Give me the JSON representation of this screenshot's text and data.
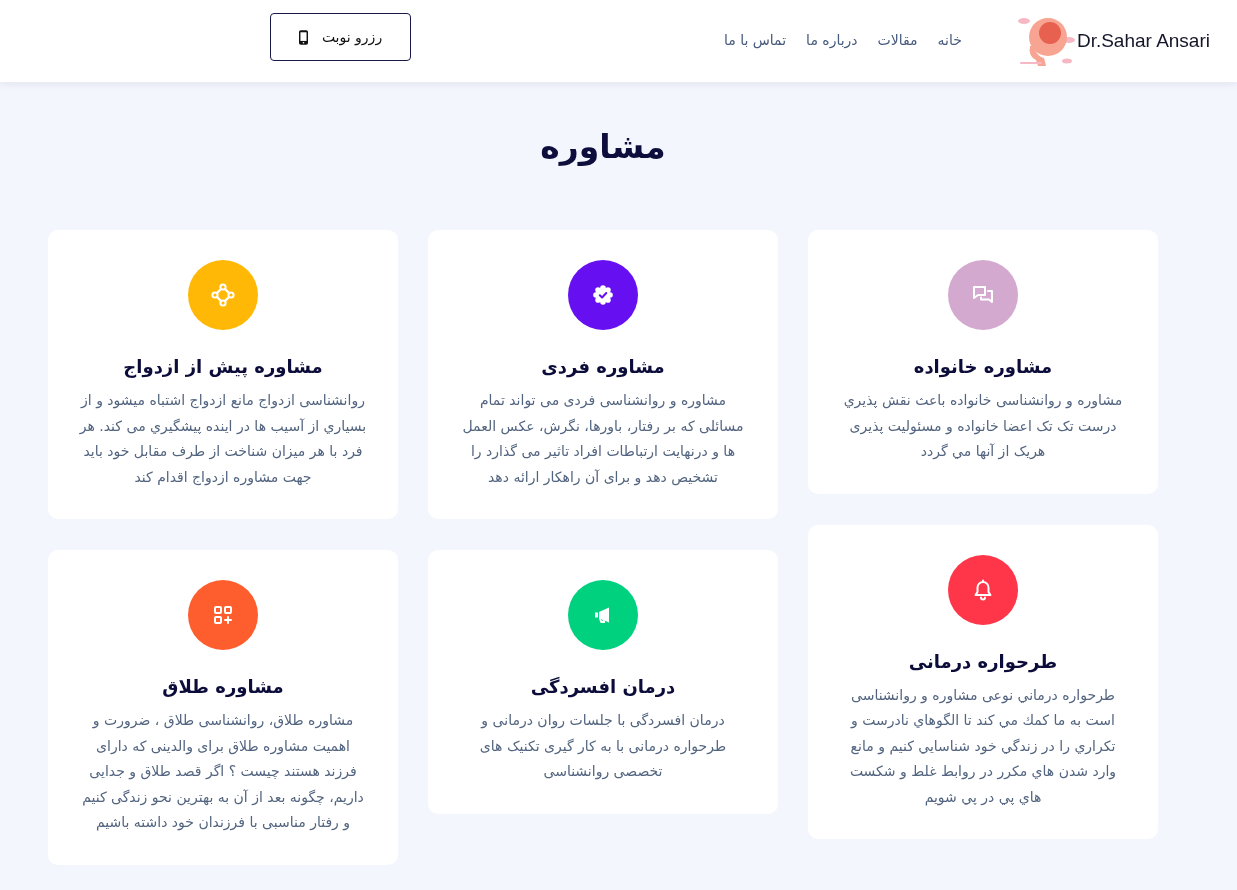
{
  "header": {
    "brand": "Dr.Sahar Ansari",
    "nav": [
      "خانه",
      "مقالات",
      "درباره ما",
      "تماس با ما"
    ],
    "booking_button": "رزرو نوبت"
  },
  "section": {
    "title": "مشاوره",
    "cards": [
      {
        "title": "مشاوره خانواده",
        "description": "مشاوره و روانشناسی خانواده باعث نقش پذيري درست تک تک اعضا خانواده و مسئولیت پذیری هریک از آنها مي گردد",
        "color": "#d4a9cf"
      },
      {
        "title": "مشاوره فردی",
        "description": "مشاوره و روانشناسی فردی می تواند تمام مسائلی که بر رفتار، باورها، نگرش، عکس العمل ها و درنهایت ارتباطات افراد تاثیر می گذارد را تشخیص دهد و برای آن راهکار ارائه دهد",
        "color": "#6610f2"
      },
      {
        "title": "مشاوره پیش از ازدواج",
        "description": "روانشناسی ازدواج مانع ازدواج اشتباه میشود و از بسياري از آسیب ها در اینده پیشگيري می کند. هر فرد با هر میزان شناخت از طرف مقابل خود باید جهت مشاوره ازدواج اقدام کند",
        "color": "#ffb805"
      },
      {
        "title": "طرحواره درمانی",
        "description": "طرحواره درماني نوعی مشاوره و روانشناسی است به ما كمك مي كند تا الگوهاي نادرست و تكراري را در زندگي خود شناسايي كنيم و مانع وارد شدن هاي مكرر در روابط غلط و شكست هاي پي در پي شويم",
        "color": "#ff3549"
      },
      {
        "title": "درمان افسردگی",
        "description": "درمان افسردگی با جلسات روان درمانی و طرحواره درمانی با به کار گیری تکنیک های تخصصی روانشناسی",
        "color": "#00d17e"
      },
      {
        "title": "مشاوره طلاق",
        "description": "مشاوره طلاق، روانشناسی طلاق ، ضرورت و اهمیت مشاوره طلاق برای والدینی که دارای فرزند هستند چیست ؟ اگر قصد طلاق و جدایی داریم، چگونه بعد از آن به بهترین نحو زندگی کنیم و رفتار مناسبی با فرزندان خود داشته باشیم",
        "color": "#fe5e2d"
      }
    ]
  }
}
